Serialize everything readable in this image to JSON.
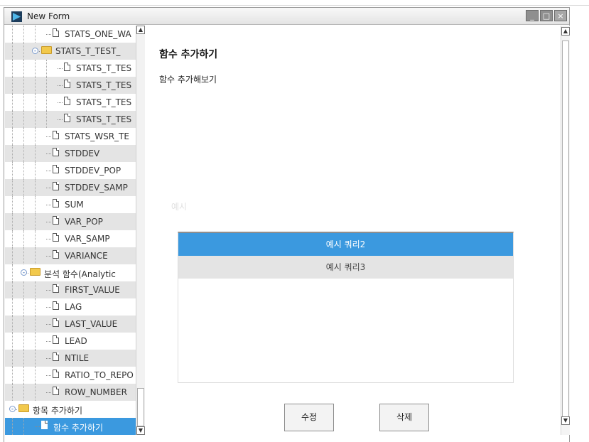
{
  "window": {
    "title": "New Form",
    "min_label": "_",
    "max_label": "□",
    "close_label": "×"
  },
  "tree": {
    "items": [
      {
        "label": "STATS_ONE_WA",
        "type": "doc",
        "level": 3
      },
      {
        "label": "STATS_T_TEST_",
        "type": "folder",
        "level": 2,
        "expanded": true
      },
      {
        "label": "STATS_T_TES",
        "type": "doc",
        "level": 4
      },
      {
        "label": "STATS_T_TES",
        "type": "doc",
        "level": 4
      },
      {
        "label": "STATS_T_TES",
        "type": "doc",
        "level": 4
      },
      {
        "label": "STATS_T_TES",
        "type": "doc",
        "level": 4
      },
      {
        "label": "STATS_WSR_TE",
        "type": "doc",
        "level": 3
      },
      {
        "label": "STDDEV",
        "type": "doc",
        "level": 3
      },
      {
        "label": "STDDEV_POP",
        "type": "doc",
        "level": 3
      },
      {
        "label": "STDDEV_SAMP",
        "type": "doc",
        "level": 3
      },
      {
        "label": "SUM",
        "type": "doc",
        "level": 3
      },
      {
        "label": "VAR_POP",
        "type": "doc",
        "level": 3
      },
      {
        "label": "VAR_SAMP",
        "type": "doc",
        "level": 3
      },
      {
        "label": "VARIANCE",
        "type": "doc",
        "level": 3
      },
      {
        "label": "분석 함수(Analytic",
        "type": "folder",
        "level": 1,
        "expanded": true
      },
      {
        "label": "FIRST_VALUE",
        "type": "doc",
        "level": 3
      },
      {
        "label": "LAG",
        "type": "doc",
        "level": 3
      },
      {
        "label": "LAST_VALUE",
        "type": "doc",
        "level": 3
      },
      {
        "label": "LEAD",
        "type": "doc",
        "level": 3
      },
      {
        "label": "NTILE",
        "type": "doc",
        "level": 3
      },
      {
        "label": "RATIO_TO_REPO",
        "type": "doc",
        "level": 3
      },
      {
        "label": "ROW_NUMBER",
        "type": "doc",
        "level": 3
      },
      {
        "label": "항목 추가하기",
        "type": "folder",
        "level": 0,
        "expanded": true
      },
      {
        "label": "함수 추가하기",
        "type": "doc",
        "level": 2,
        "selected": true
      }
    ]
  },
  "main": {
    "title": "함수 추가하기",
    "subtitle": "함수 추가해보기",
    "example_label": "예시",
    "queries": [
      "예시 쿼리2",
      "예시 쿼리3"
    ],
    "edit_button": "수정",
    "delete_button": "삭제"
  },
  "colors": {
    "accent": "#3b99df",
    "row_alt": "#e4e4e4"
  }
}
